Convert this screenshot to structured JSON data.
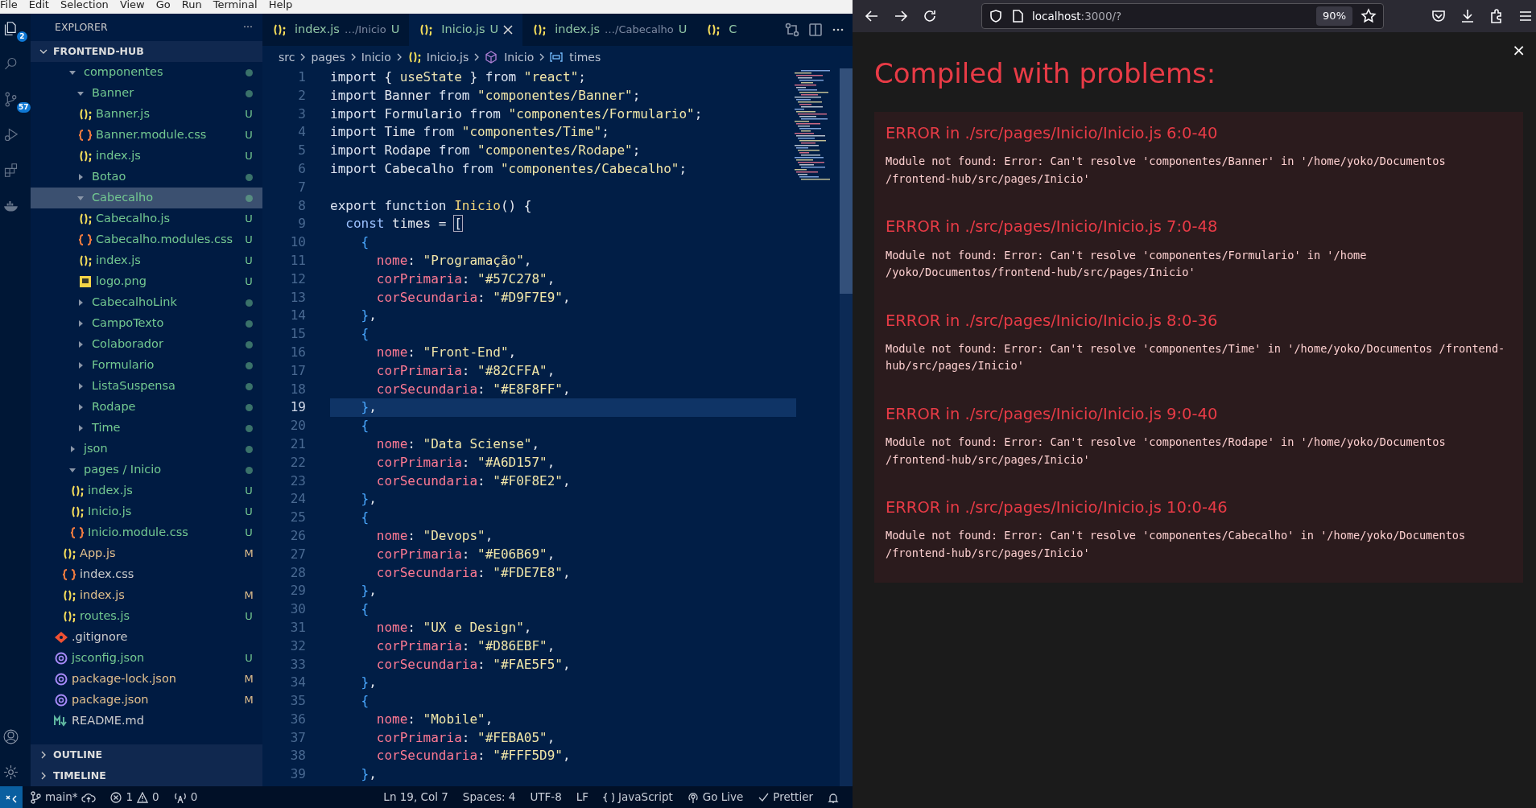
{
  "menu_bar": [
    "File",
    "Edit",
    "Selection",
    "View",
    "Go",
    "Run",
    "Terminal",
    "Help"
  ],
  "activity_bar": [
    {
      "kind": "explorer",
      "badge": "2",
      "selected": true
    },
    {
      "kind": "search",
      "selected": false
    },
    {
      "kind": "source-control",
      "badge": "57",
      "selected": false
    },
    {
      "kind": "run",
      "selected": false
    },
    {
      "kind": "extensions",
      "selected": false
    },
    {
      "kind": "docker",
      "selected": false
    }
  ],
  "activity_bar_bottom": [
    {
      "kind": "account"
    },
    {
      "kind": "settings"
    }
  ],
  "explorer": {
    "title": "EXPLORER",
    "more": "···",
    "section": {
      "label": "FRONTEND-HUB",
      "expanded": true
    },
    "tree": [
      {
        "label": "componentes",
        "kind": "folder",
        "expanded": true,
        "selected": false,
        "color": "#73c991",
        "children": [
          {
            "label": "Banner",
            "kind": "folder",
            "expanded": true,
            "selected": false,
            "color": "#73c991",
            "children": [
              {
                "label": "Banner.js",
                "kind": "js",
                "color": "#73c991",
                "badge": "U",
                "selected": false
              },
              {
                "label": "Banner.module.css",
                "kind": "css",
                "color": "#73c991",
                "badge": "U",
                "selected": false
              },
              {
                "label": "index.js",
                "kind": "js",
                "color": "#73c991",
                "badge": "U",
                "selected": false
              }
            ]
          },
          {
            "label": "Botao",
            "kind": "folder",
            "expanded": false,
            "selected": false,
            "color": "#73c991"
          },
          {
            "label": "Cabecalho",
            "kind": "folder",
            "expanded": true,
            "selected": true,
            "color": "#73c991",
            "children": [
              {
                "label": "Cabecalho.js",
                "kind": "js",
                "color": "#73c991",
                "badge": "U",
                "selected": false
              },
              {
                "label": "Cabecalho.modules.css",
                "kind": "css",
                "color": "#73c991",
                "badge": "U",
                "selected": false
              },
              {
                "label": "index.js",
                "kind": "js",
                "color": "#73c991",
                "badge": "U",
                "selected": false
              },
              {
                "label": "logo.png",
                "kind": "image",
                "color": "#73c991",
                "badge": "U",
                "selected": false
              }
            ]
          },
          {
            "label": "CabecalhoLink",
            "kind": "folder",
            "expanded": false,
            "selected": false,
            "color": "#73c991"
          },
          {
            "label": "CampoTexto",
            "kind": "folder",
            "expanded": false,
            "selected": false,
            "color": "#73c991"
          },
          {
            "label": "Colaborador",
            "kind": "folder",
            "expanded": false,
            "selected": false,
            "color": "#73c991"
          },
          {
            "label": "Formulario",
            "kind": "folder",
            "expanded": false,
            "selected": false,
            "color": "#73c991"
          },
          {
            "label": "ListaSuspensa",
            "kind": "folder",
            "expanded": false,
            "selected": false,
            "color": "#73c991"
          },
          {
            "label": "Rodape",
            "kind": "folder",
            "expanded": false,
            "selected": false,
            "color": "#73c991"
          },
          {
            "label": "Time",
            "kind": "folder",
            "expanded": false,
            "selected": false,
            "color": "#73c991"
          }
        ]
      },
      {
        "label": "json",
        "kind": "folder",
        "expanded": false,
        "selected": false,
        "color": "#73c991"
      },
      {
        "label": "pages / Inicio",
        "kind": "folder",
        "expanded": true,
        "selected": false,
        "color": "#73c991",
        "children": [
          {
            "label": "index.js",
            "kind": "js",
            "color": "#73c991",
            "badge": "U",
            "selected": false
          },
          {
            "label": "Inicio.js",
            "kind": "js",
            "color": "#73c991",
            "badge": "U",
            "selected": false
          },
          {
            "label": "Inicio.module.css",
            "kind": "css",
            "color": "#73c991",
            "badge": "U",
            "selected": false
          }
        ]
      },
      {
        "label": "App.js",
        "kind": "js",
        "color": "#e2c08d",
        "badge": "M",
        "selected": false
      },
      {
        "label": "index.css",
        "kind": "css",
        "color": "#cccccc",
        "selected": false
      },
      {
        "label": "index.js",
        "kind": "js",
        "color": "#e2c08d",
        "badge": "M",
        "selected": false
      },
      {
        "label": "routes.js",
        "kind": "js",
        "color": "#73c991",
        "badge": "U",
        "selected": false
      }
    ],
    "root_files": [
      {
        "label": ".gitignore",
        "kind": "git",
        "color": "#cccccc",
        "selected": false
      },
      {
        "label": "jsconfig.json",
        "kind": "json",
        "color": "#73c991",
        "badge": "U",
        "selected": false
      },
      {
        "label": "package-lock.json",
        "kind": "json",
        "color": "#e2c08d",
        "badge": "M",
        "selected": false
      },
      {
        "label": "package.json",
        "kind": "json",
        "color": "#e2c08d",
        "badge": "M",
        "selected": false
      },
      {
        "label": "README.md",
        "kind": "md",
        "color": "#cccccc",
        "selected": false
      }
    ],
    "panels": [
      {
        "label": "OUTLINE",
        "expanded": false
      },
      {
        "label": "TIMELINE",
        "expanded": false
      }
    ]
  },
  "tabs": [
    {
      "label": "index.js",
      "description": "…/Inicio",
      "badge": "U",
      "selected": false
    },
    {
      "label": "Inicio.js",
      "badge": "U",
      "selected": true
    },
    {
      "label": "index.js",
      "description": "…/Cabecalho",
      "badge": "U",
      "selected": false
    },
    {
      "label": "C",
      "selected": false
    }
  ],
  "breadcrumbs": [
    {
      "label": "src",
      "kind": "folder"
    },
    {
      "label": "pages",
      "kind": "folder"
    },
    {
      "label": "Inicio",
      "kind": "folder"
    },
    {
      "label": "Inicio.js",
      "kind": "js"
    },
    {
      "label": "Inicio",
      "kind": "component"
    },
    {
      "label": "times",
      "kind": "variable"
    }
  ],
  "code": [
    {
      "number": "1",
      "current": false,
      "tokens": [
        {
          "kind": "kw",
          "text": "import"
        },
        {
          "kind": "p",
          "text": " { "
        },
        {
          "kind": "v",
          "text": "useState"
        },
        {
          "kind": "p",
          "text": " } "
        },
        {
          "kind": "kw",
          "text": "from"
        },
        {
          "kind": "s",
          "text": " \"react\""
        },
        {
          "kind": "p",
          "text": ";"
        }
      ]
    },
    {
      "number": "2",
      "current": false,
      "tokens": [
        {
          "kind": "kw",
          "text": "import"
        },
        {
          "kind": "p",
          "text": " Banner "
        },
        {
          "kind": "kw",
          "text": "from"
        },
        {
          "kind": "s",
          "text": " \"componentes/Banner\""
        },
        {
          "kind": "p",
          "text": ";"
        }
      ]
    },
    {
      "number": "3",
      "current": false,
      "tokens": [
        {
          "kind": "kw",
          "text": "import"
        },
        {
          "kind": "p",
          "text": " Formulario "
        },
        {
          "kind": "kw",
          "text": "from"
        },
        {
          "kind": "s",
          "text": " \"componentes/Formulario\""
        },
        {
          "kind": "p",
          "text": ";"
        }
      ]
    },
    {
      "number": "4",
      "current": false,
      "tokens": [
        {
          "kind": "kw",
          "text": "import"
        },
        {
          "kind": "p",
          "text": " Time "
        },
        {
          "kind": "kw",
          "text": "from"
        },
        {
          "kind": "s",
          "text": " \"componentes/Time\""
        },
        {
          "kind": "p",
          "text": ";"
        }
      ]
    },
    {
      "number": "5",
      "current": false,
      "tokens": [
        {
          "kind": "kw",
          "text": "import"
        },
        {
          "kind": "p",
          "text": " Rodape "
        },
        {
          "kind": "kw",
          "text": "from"
        },
        {
          "kind": "s",
          "text": " \"componentes/Rodape\""
        },
        {
          "kind": "p",
          "text": ";"
        }
      ]
    },
    {
      "number": "6",
      "current": false,
      "tokens": [
        {
          "kind": "kw",
          "text": "import"
        },
        {
          "kind": "p",
          "text": " Cabecalho "
        },
        {
          "kind": "kw",
          "text": "from"
        },
        {
          "kind": "s",
          "text": " \"componentes/Cabecalho\""
        },
        {
          "kind": "p",
          "text": ";"
        }
      ]
    },
    {
      "number": "7",
      "current": false
    },
    {
      "number": "8",
      "current": false,
      "tokens": [
        {
          "kind": "kw",
          "text": "export"
        },
        {
          "kind": "kw",
          "text": " function"
        },
        {
          "kind": "fn",
          "text": " Inicio"
        },
        {
          "kind": "p",
          "text": "() {"
        }
      ]
    },
    {
      "number": "9",
      "current": false,
      "tokens": [
        {
          "kind": "kw2",
          "text": "  const"
        },
        {
          "kind": "p",
          "text": " times = "
        },
        {
          "kind": "match",
          "text": "["
        }
      ]
    },
    {
      "number": "10",
      "current": false,
      "tokens": [
        {
          "kind": "b",
          "text": "    {"
        }
      ]
    },
    {
      "number": "11",
      "current": false,
      "tokens": [
        {
          "kind": "prop",
          "text": "      nome"
        },
        {
          "kind": "p",
          "text": ": "
        },
        {
          "kind": "s",
          "text": "\"Programação\""
        },
        {
          "kind": "p",
          "text": ","
        }
      ]
    },
    {
      "number": "12",
      "current": false,
      "tokens": [
        {
          "kind": "prop",
          "text": "      corPrimaria"
        },
        {
          "kind": "p",
          "text": ": "
        },
        {
          "kind": "s",
          "text": "\"#57C278\""
        },
        {
          "kind": "p",
          "text": ","
        }
      ]
    },
    {
      "number": "13",
      "current": false,
      "tokens": [
        {
          "kind": "prop",
          "text": "      corSecundaria"
        },
        {
          "kind": "p",
          "text": ": "
        },
        {
          "kind": "s",
          "text": "\"#D9F7E9\""
        },
        {
          "kind": "p",
          "text": ","
        }
      ]
    },
    {
      "number": "14",
      "current": false,
      "tokens": [
        {
          "kind": "b",
          "text": "    }"
        },
        {
          "kind": "p",
          "text": ","
        }
      ]
    },
    {
      "number": "15",
      "current": false,
      "tokens": [
        {
          "kind": "b",
          "text": "    {"
        }
      ]
    },
    {
      "number": "16",
      "current": false,
      "tokens": [
        {
          "kind": "prop",
          "text": "      nome"
        },
        {
          "kind": "p",
          "text": ": "
        },
        {
          "kind": "s",
          "text": "\"Front-End\""
        },
        {
          "kind": "p",
          "text": ","
        }
      ]
    },
    {
      "number": "17",
      "current": false,
      "tokens": [
        {
          "kind": "prop",
          "text": "      corPrimaria"
        },
        {
          "kind": "p",
          "text": ": "
        },
        {
          "kind": "s",
          "text": "\"#82CFFA\""
        },
        {
          "kind": "p",
          "text": ","
        }
      ]
    },
    {
      "number": "18",
      "current": false,
      "tokens": [
        {
          "kind": "prop",
          "text": "      corSecundaria"
        },
        {
          "kind": "p",
          "text": ": "
        },
        {
          "kind": "s",
          "text": "\"#E8F8FF\""
        },
        {
          "kind": "p",
          "text": ","
        }
      ]
    },
    {
      "number": "19",
      "current": true,
      "tokens": [
        {
          "kind": "b",
          "text": "    }"
        },
        {
          "kind": "p",
          "text": ","
        }
      ]
    },
    {
      "number": "20",
      "current": false,
      "tokens": [
        {
          "kind": "b",
          "text": "    {"
        }
      ]
    },
    {
      "number": "21",
      "current": false,
      "tokens": [
        {
          "kind": "prop",
          "text": "      nome"
        },
        {
          "kind": "p",
          "text": ": "
        },
        {
          "kind": "s",
          "text": "\"Data Sciense\""
        },
        {
          "kind": "p",
          "text": ","
        }
      ]
    },
    {
      "number": "22",
      "current": false,
      "tokens": [
        {
          "kind": "prop",
          "text": "      corPrimaria"
        },
        {
          "kind": "p",
          "text": ": "
        },
        {
          "kind": "s",
          "text": "\"#A6D157\""
        },
        {
          "kind": "p",
          "text": ","
        }
      ]
    },
    {
      "number": "23",
      "current": false,
      "tokens": [
        {
          "kind": "prop",
          "text": "      corSecundaria"
        },
        {
          "kind": "p",
          "text": ": "
        },
        {
          "kind": "s",
          "text": "\"#F0F8E2\""
        },
        {
          "kind": "p",
          "text": ","
        }
      ]
    },
    {
      "number": "24",
      "current": false,
      "tokens": [
        {
          "kind": "b",
          "text": "    }"
        },
        {
          "kind": "p",
          "text": ","
        }
      ]
    },
    {
      "number": "25",
      "current": false,
      "tokens": [
        {
          "kind": "b",
          "text": "    {"
        }
      ]
    },
    {
      "number": "26",
      "current": false,
      "tokens": [
        {
          "kind": "prop",
          "text": "      nome"
        },
        {
          "kind": "p",
          "text": ": "
        },
        {
          "kind": "s",
          "text": "\"Devops\""
        },
        {
          "kind": "p",
          "text": ","
        }
      ]
    },
    {
      "number": "27",
      "current": false,
      "tokens": [
        {
          "kind": "prop",
          "text": "      corPrimaria"
        },
        {
          "kind": "p",
          "text": ": "
        },
        {
          "kind": "s",
          "text": "\"#E06B69\""
        },
        {
          "kind": "p",
          "text": ","
        }
      ]
    },
    {
      "number": "28",
      "current": false,
      "tokens": [
        {
          "kind": "prop",
          "text": "      corSecundaria"
        },
        {
          "kind": "p",
          "text": ": "
        },
        {
          "kind": "s",
          "text": "\"#FDE7E8\""
        },
        {
          "kind": "p",
          "text": ","
        }
      ]
    },
    {
      "number": "29",
      "current": false,
      "tokens": [
        {
          "kind": "b",
          "text": "    }"
        },
        {
          "kind": "p",
          "text": ","
        }
      ]
    },
    {
      "number": "30",
      "current": false,
      "tokens": [
        {
          "kind": "b",
          "text": "    {"
        }
      ]
    },
    {
      "number": "31",
      "current": false,
      "tokens": [
        {
          "kind": "prop",
          "text": "      nome"
        },
        {
          "kind": "p",
          "text": ": "
        },
        {
          "kind": "s",
          "text": "\"UX e Design\""
        },
        {
          "kind": "p",
          "text": ","
        }
      ]
    },
    {
      "number": "32",
      "current": false,
      "tokens": [
        {
          "kind": "prop",
          "text": "      corPrimaria"
        },
        {
          "kind": "p",
          "text": ": "
        },
        {
          "kind": "s",
          "text": "\"#D86EBF\""
        },
        {
          "kind": "p",
          "text": ","
        }
      ]
    },
    {
      "number": "33",
      "current": false,
      "tokens": [
        {
          "kind": "prop",
          "text": "      corSecundaria"
        },
        {
          "kind": "p",
          "text": ": "
        },
        {
          "kind": "s",
          "text": "\"#FAE5F5\""
        },
        {
          "kind": "p",
          "text": ","
        }
      ]
    },
    {
      "number": "34",
      "current": false,
      "tokens": [
        {
          "kind": "b",
          "text": "    }"
        },
        {
          "kind": "p",
          "text": ","
        }
      ]
    },
    {
      "number": "35",
      "current": false,
      "tokens": [
        {
          "kind": "b",
          "text": "    {"
        }
      ]
    },
    {
      "number": "36",
      "current": false,
      "tokens": [
        {
          "kind": "prop",
          "text": "      nome"
        },
        {
          "kind": "p",
          "text": ": "
        },
        {
          "kind": "s",
          "text": "\"Mobile\""
        },
        {
          "kind": "p",
          "text": ","
        }
      ]
    },
    {
      "number": "37",
      "current": false,
      "tokens": [
        {
          "kind": "prop",
          "text": "      corPrimaria"
        },
        {
          "kind": "p",
          "text": ": "
        },
        {
          "kind": "s",
          "text": "\"#FEBA05\""
        },
        {
          "kind": "p",
          "text": ","
        }
      ]
    },
    {
      "number": "38",
      "current": false,
      "tokens": [
        {
          "kind": "prop",
          "text": "      corSecundaria"
        },
        {
          "kind": "p",
          "text": ": "
        },
        {
          "kind": "s",
          "text": "\"#FFF5D9\""
        },
        {
          "kind": "p",
          "text": ","
        }
      ]
    },
    {
      "number": "39",
      "current": false,
      "tokens": [
        {
          "kind": "b",
          "text": "    }"
        },
        {
          "kind": "p",
          "text": ","
        }
      ]
    }
  ],
  "status_bar": {
    "branch": "main*",
    "errors": "1",
    "warnings": "0",
    "ports": "0",
    "right": [
      {
        "kind": "text",
        "label": "Ln 19, Col 7"
      },
      {
        "kind": "text",
        "label": "Spaces: 4"
      },
      {
        "kind": "text",
        "label": "UTF-8"
      },
      {
        "kind": "text",
        "label": "LF"
      },
      {
        "kind": "braces",
        "label": "JavaScript"
      },
      {
        "kind": "live",
        "label": "Go Live"
      },
      {
        "kind": "check",
        "label": "Prettier"
      },
      {
        "kind": "bell"
      }
    ]
  },
  "browser": {
    "url_host": "localhost",
    "url_rest": ":3000/?",
    "zoom": "90%"
  },
  "overlay": {
    "title": "Compiled with problems:",
    "close": "×",
    "errors": [
      {
        "heading": "ERROR in ./src/pages/Inicio/Inicio.js 6:0-40",
        "message": "Module not found: Error: Can't resolve 'componentes/Banner' in '/home/yoko/Documentos /frontend-hub/src/pages/Inicio'"
      },
      {
        "heading": "ERROR in ./src/pages/Inicio/Inicio.js 7:0-48",
        "message": "Module not found: Error: Can't resolve 'componentes/Formulario' in '/home /yoko/Documentos/frontend-hub/src/pages/Inicio'"
      },
      {
        "heading": "ERROR in ./src/pages/Inicio/Inicio.js 8:0-36",
        "message": "Module not found: Error: Can't resolve 'componentes/Time' in '/home/yoko/Documentos /frontend-hub/src/pages/Inicio'"
      },
      {
        "heading": "ERROR in ./src/pages/Inicio/Inicio.js 9:0-40",
        "message": "Module not found: Error: Can't resolve 'componentes/Rodape' in '/home/yoko/Documentos /frontend-hub/src/pages/Inicio'"
      },
      {
        "heading": "ERROR in ./src/pages/Inicio/Inicio.js 10:0-46",
        "message": "Module not found: Error: Can't resolve 'componentes/Cabecalho' in '/home/yoko/Documentos /frontend-hub/src/pages/Inicio'"
      }
    ]
  }
}
